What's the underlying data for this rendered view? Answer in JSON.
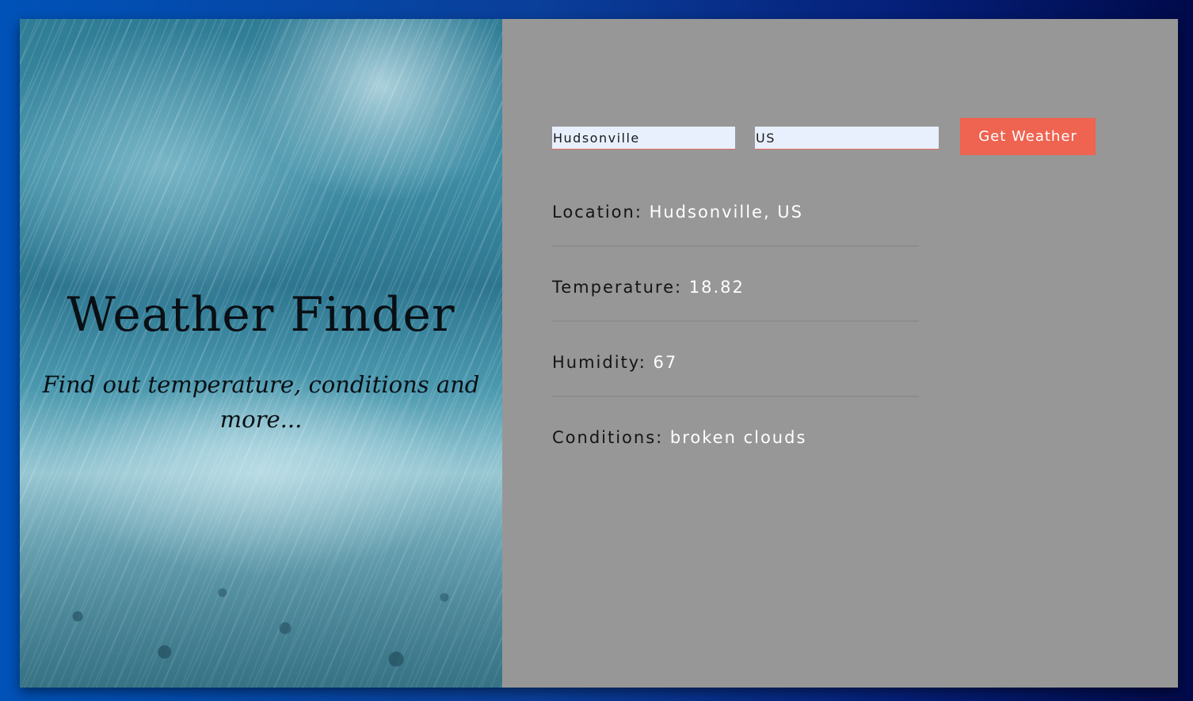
{
  "hero": {
    "title": "Weather Finder",
    "subtitle": "Find out temperature, conditions and more..."
  },
  "form": {
    "city_value": "Hudsonville",
    "country_value": "US",
    "submit_label": "Get Weather"
  },
  "results": {
    "location_label": "Location:",
    "location_value": "Hudsonville, US",
    "temperature_label": "Temperature:",
    "temperature_value": "18.82",
    "humidity_label": "Humidity:",
    "humidity_value": "67",
    "conditions_label": "Conditions:",
    "conditions_value": "broken clouds"
  },
  "colors": {
    "accent_button": "#ef6351",
    "panel_background": "#979797",
    "input_background": "#e8f0fe"
  }
}
